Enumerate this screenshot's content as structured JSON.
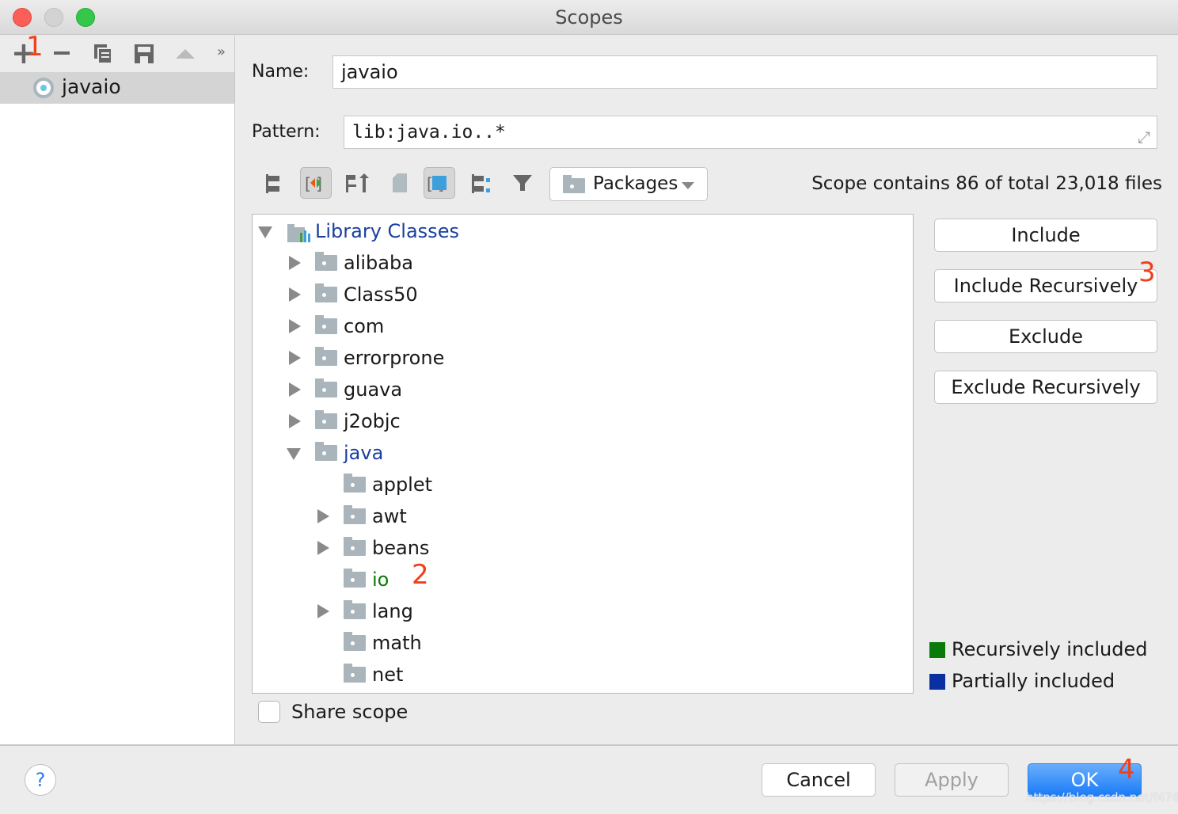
{
  "window": {
    "title": "Scopes"
  },
  "left_toolbar": {
    "annotation": "1",
    "items": [
      "add-icon",
      "remove-icon",
      "copy-icon",
      "save-icon",
      "move-up-icon",
      "more-icon"
    ]
  },
  "scopes": [
    {
      "label": "javaio",
      "selected": true
    }
  ],
  "form": {
    "name_label": "Name:",
    "name_value": "javaio",
    "pattern_label": "Pattern:",
    "pattern_value": "lib:java.io..*"
  },
  "toolbar": {
    "view_select": "Packages",
    "scope_info": "Scope contains 86 of total 23,018 files"
  },
  "tree": [
    {
      "label": "Library Classes",
      "level": 0,
      "expanded": true,
      "color": "#1a3fa0"
    },
    {
      "label": "alibaba",
      "level": 1,
      "expandable": true
    },
    {
      "label": "Class50",
      "level": 1,
      "expandable": true
    },
    {
      "label": "com",
      "level": 1,
      "expandable": true
    },
    {
      "label": "errorprone",
      "level": 1,
      "expandable": true
    },
    {
      "label": "guava",
      "level": 1,
      "expandable": true
    },
    {
      "label": "j2objc",
      "level": 1,
      "expandable": true
    },
    {
      "label": "java",
      "level": 1,
      "expanded": true,
      "color": "#1a3fa0"
    },
    {
      "label": "applet",
      "level": 2
    },
    {
      "label": "awt",
      "level": 2,
      "expandable": true
    },
    {
      "label": "beans",
      "level": 2,
      "expandable": true
    },
    {
      "label": "io",
      "level": 2,
      "color": "#0b7a0b",
      "annotation": "2"
    },
    {
      "label": "lang",
      "level": 2,
      "expandable": true
    },
    {
      "label": "math",
      "level": 2
    },
    {
      "label": "net",
      "level": 2
    }
  ],
  "actions": {
    "include": "Include",
    "include_recursively": "Include Recursively",
    "include_annotation": "3",
    "exclude": "Exclude",
    "exclude_recursively": "Exclude Recursively"
  },
  "legend": [
    {
      "label": "Recursively included",
      "color": "#0a7a0a"
    },
    {
      "label": "Partially included",
      "color": "#0a2fa0"
    }
  ],
  "share_scope": {
    "label": "Share scope",
    "checked": false
  },
  "footer": {
    "help": "?",
    "cancel": "Cancel",
    "apply": "Apply",
    "ok": "OK",
    "ok_annotation": "4",
    "watermark": "https://blog.csdn.net/f4761"
  }
}
